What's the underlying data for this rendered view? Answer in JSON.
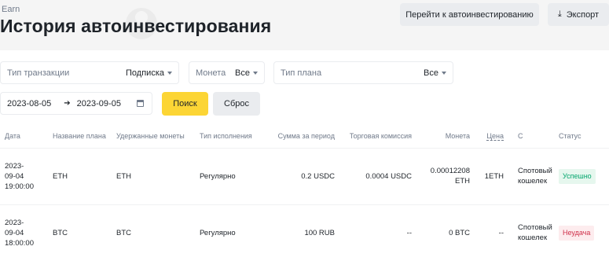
{
  "header": {
    "eyebrow": "Earn",
    "title": "История автоинвестирования",
    "autoinvest_label": "Перейти к автоинвестированию",
    "export_label": "Экспорт"
  },
  "filters": {
    "tx_type": {
      "placeholder": "Тип транзакции",
      "value": "Подписка"
    },
    "coin": {
      "placeholder": "Монета",
      "value": "Все"
    },
    "plan_type": {
      "placeholder": "Тип плана",
      "value": "Все"
    },
    "date_from": "2023-08-05",
    "date_to": "2023-09-05",
    "search_label": "Поиск",
    "reset_label": "Сброс"
  },
  "table": {
    "columns": [
      "Дата",
      "Название плана",
      "Удержанные монеты",
      "Тип исполнения",
      "Сумма за период",
      "Торговая комиссия",
      "Монета",
      "Цена",
      "С",
      "Статус"
    ],
    "rows": [
      {
        "date1": "2023-",
        "date2": "09-04",
        "date3": "19:00:00",
        "plan": "ETH",
        "held": "ETH",
        "exec": "Регулярно",
        "amount": "0.2 USDC",
        "fee": "0.0004 USDC",
        "coin1": "0.00012208",
        "coin2": "ETH",
        "price": "1ETH",
        "from1": "Спотовый",
        "from2": "кошелек",
        "status": "Успешно"
      },
      {
        "date1": "2023-",
        "date2": "09-04",
        "date3": "18:00:00",
        "plan": "BTC",
        "held": "BTC",
        "exec": "Регулярно",
        "amount": "100 RUB",
        "fee": "--",
        "coin1": "0 BTC",
        "coin2": "",
        "price": "--",
        "from1": "Спотовый",
        "from2": "кошелек",
        "status": "Неудача"
      }
    ]
  },
  "colors": {
    "accent": "#fcd535",
    "success": "#03a66d",
    "fail": "#cf304a"
  }
}
